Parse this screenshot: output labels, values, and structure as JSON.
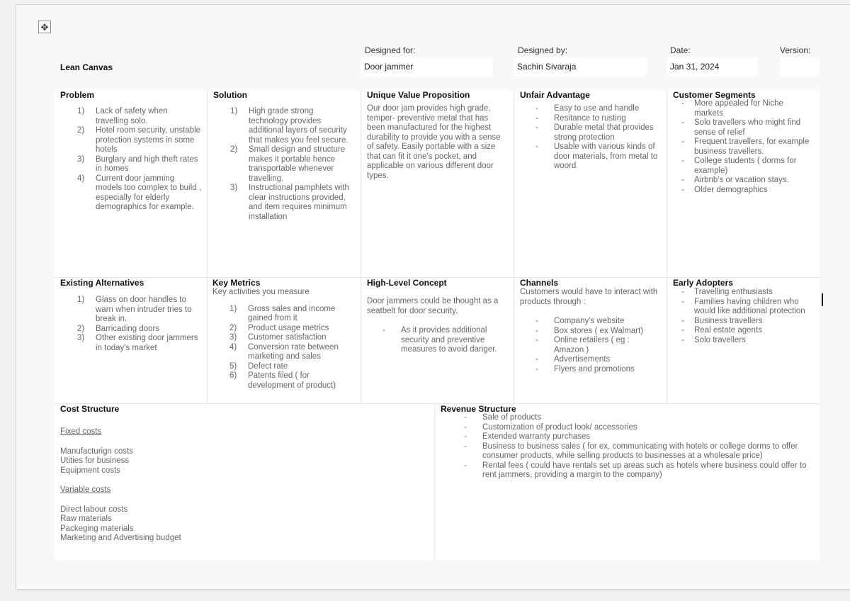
{
  "canvas": {
    "title": "Lean Canvas",
    "designed_for_label": "Designed for:",
    "designed_for_value": "Door jammer",
    "designed_by_label": "Designed by:",
    "designed_by_value": "Sachin Sivaraja",
    "date_label": "Date:",
    "date_value": "Jan 31, 2024",
    "version_label": "Version:",
    "version_value": ""
  },
  "problem": {
    "heading": "Problem",
    "items": [
      {
        "n": "1)",
        "text": "Lack of safety when travelling solo."
      },
      {
        "n": "2)",
        "text": "Hotel room security, unstable protection systems in some hotels"
      },
      {
        "n": "3)",
        "text": "Burglary and high theft rates in homes"
      },
      {
        "n": "4)",
        "text": "Current door jamming models too complex to build , especially for elderly demographics for example."
      }
    ]
  },
  "solution": {
    "heading": "Solution",
    "items": [
      {
        "n": "1)",
        "text": "High grade strong technology provides additional layers of security that makes you feel secure."
      },
      {
        "n": "2)",
        "text": "Small design and structure makes it portable hence transportable whenever travelling."
      },
      {
        "n": "3)",
        "text": "Instructional pamphlets with clear instructions provided, and item requires minimum installation"
      }
    ]
  },
  "uvp": {
    "heading": "Unique Value Proposition",
    "text": "Our door jam provides high grade, temper- preventive metal that has been manufactured for the highest durability to provide you with a sense of safety. Easily portable with a size that can fit it one's pocket, and applicable on various different door types."
  },
  "unfair_advantage": {
    "heading": "Unfair Advantage",
    "items": [
      "Easy to use and handle",
      "Resitance to rusting",
      "Durable metal that provides strong protection",
      "Usable with various kinds of door materials, from metal to woord"
    ]
  },
  "customer_segments": {
    "heading": "Customer Segments",
    "items": [
      "More appealed for Niche markets",
      "Solo travellers who might find sense of relief",
      "Frequent travellers, for example business travellers.",
      "College students ( dorms for example)",
      "Airbnb's or vacation stays.",
      "Older demographics"
    ]
  },
  "existing_alternatives": {
    "heading": "Existing Alternatives",
    "items": [
      {
        "n": "1)",
        "text": "Glass on door handles to warn when intruder tries to break in."
      },
      {
        "n": "2)",
        "text": "Barricading doors"
      },
      {
        "n": "3)",
        "text": "Other existing door jammers in today's market"
      }
    ]
  },
  "key_metrics": {
    "heading": "Key Metrics",
    "intro": "Key activities you measure",
    "items": [
      {
        "n": "1)",
        "text": "Gross sales and income gained from it"
      },
      {
        "n": "2)",
        "text": "Product usage metrics"
      },
      {
        "n": "3)",
        "text": "Customer satisfaction"
      },
      {
        "n": "4)",
        "text": "Conversion rate between marketing and sales"
      },
      {
        "n": "5)",
        "text": "Defect rate"
      },
      {
        "n": "6)",
        "text": "Patents filed ( for development of product)"
      }
    ]
  },
  "high_level_concept": {
    "heading": "High-Level Concept",
    "text": "Door jammers could be thought as a seatbelt for door security.",
    "items": [
      "As it provides additional security and preventive measures to avoid danger."
    ]
  },
  "channels": {
    "heading": "Channels",
    "intro": "Customers would have to interact with products through :",
    "items": [
      "Company's website",
      "Box stores ( ex Walmart)",
      "Online retailers ( eg : Amazon )",
      "Advertisements",
      "Flyers and promotions"
    ]
  },
  "early_adopters": {
    "heading": "Early Adopters",
    "items": [
      "Travelling enthusiasts",
      "Families having children who would like additional protection",
      "Business travellers",
      "Real estate agents",
      "Solo travellers"
    ]
  },
  "cost_structure": {
    "heading": "Cost Structure",
    "fixed_heading": "Fixed costs",
    "fixed_items": [
      "Manufacturign costs",
      "Utities for business",
      "Equipment costs"
    ],
    "variable_heading": "Variable costs",
    "variable_items": [
      "Direct labour costs",
      "Raw materials",
      "Packeging materials",
      "Marketing and Advertising budget"
    ]
  },
  "revenue_structure": {
    "heading": "Revenue Structure",
    "items": [
      "Sale of products",
      "Customization of product look/ accessories",
      "Extended warranty purchases",
      "Business to business sales ( for ex, communicating with hotels or college dorms to offer consumer products, while selling products to businesses at a wholesale price)",
      "Rental fees ( could have rentals set up areas such as hotels where business could offer to rent jammers, providing a margin to the company)"
    ]
  },
  "icons": {
    "move_handle": "✥",
    "dash": "-"
  }
}
